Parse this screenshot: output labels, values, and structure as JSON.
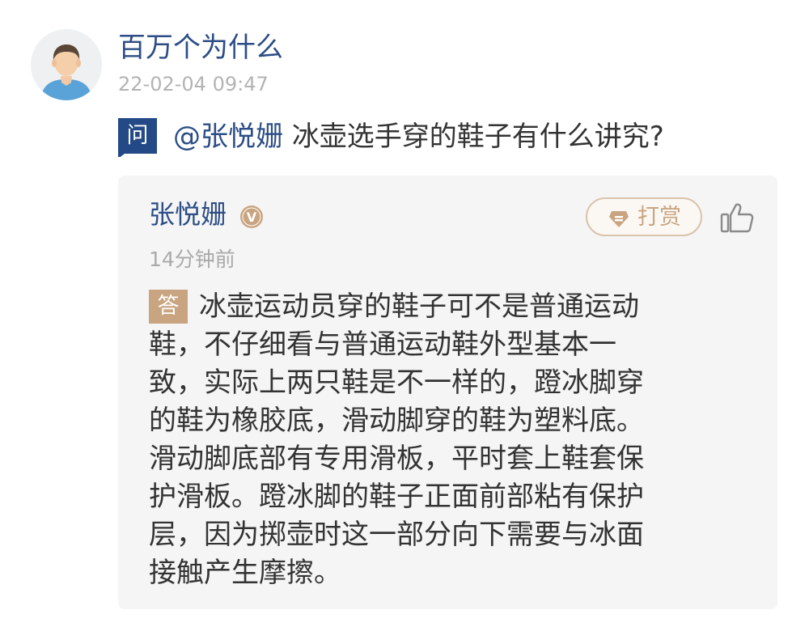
{
  "asker": {
    "name": "百万个为什么",
    "time": "22-02-04 09:47"
  },
  "question": {
    "badge": "问",
    "mention": "@张悦姗",
    "text": "冰壶选手穿的鞋子有什么讲究?"
  },
  "answer": {
    "name": "张悦姗",
    "verified_badge": "V",
    "time": "14分钟前",
    "badge": "答",
    "tip_label": "打赏",
    "lines": [
      "冰壶运动员穿的鞋子可不是普通运动",
      "鞋，不仔细看与普通运动鞋外型基本一",
      "致，实际上两只鞋是不一样的，蹬冰脚穿",
      "的鞋为橡胶底，滑动脚穿的鞋为塑料底。",
      "滑动脚底部有专用滑板，平时套上鞋套保",
      "护滑板。蹬冰脚的鞋子正面前部粘有保护",
      "层，因为掷壶时这一部分向下需要与冰面",
      "接触产生摩擦。"
    ]
  },
  "colors": {
    "link_blue": "#2c4d86",
    "gold": "#c9a480",
    "card_bg": "#f5f5f5",
    "text": "#333333",
    "muted": "#aaaaaa"
  },
  "icons": {
    "avatar": "user-avatar",
    "verified": "verified-v-icon",
    "tip": "diamond-tip-icon",
    "like": "thumbs-up-icon"
  }
}
